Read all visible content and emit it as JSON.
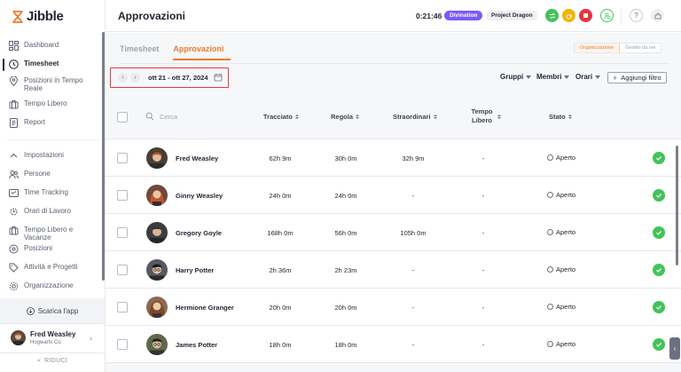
{
  "app": {
    "name": "Jibble"
  },
  "sidebar": {
    "items": [
      {
        "label": "Dashboard",
        "icon": "dashboard-icon"
      },
      {
        "label": "Timesheet",
        "icon": "clock-icon",
        "active": true
      },
      {
        "label": "Posizioni in Tempo Reale",
        "icon": "location-icon"
      },
      {
        "label": "Tempo Libero",
        "icon": "luggage-icon"
      },
      {
        "label": "Report",
        "icon": "report-icon"
      }
    ],
    "settings_items": [
      {
        "label": "Impostazioni",
        "icon": "chevron-up-icon"
      },
      {
        "label": "Persone",
        "icon": "people-icon"
      },
      {
        "label": "Time Tracking",
        "icon": "time-tracking-icon"
      },
      {
        "label": "Orari di Lavoro",
        "icon": "work-schedule-icon"
      },
      {
        "label": "Tempo Libero e Vacanze",
        "icon": "luggage-icon"
      },
      {
        "label": "Posizioni",
        "icon": "location-icon"
      },
      {
        "label": "Attività e Progetti",
        "icon": "tag-icon"
      },
      {
        "label": "Organizzazione",
        "icon": "gear-icon"
      }
    ],
    "download_label": "Scarica l'app",
    "user": {
      "name": "Fred Weasley",
      "org": "Hogwarts Co"
    },
    "collapse_label": "RIDUCI"
  },
  "header": {
    "title": "Approvazioni",
    "timer": "0:21:46",
    "activity": "Divination",
    "project": "Project Dragon",
    "colors": {
      "activity": "#7a5af8",
      "start": "#43c35a",
      "break": "#f5b400",
      "stop": "#e5363d"
    }
  },
  "tabs": [
    {
      "label": "Timesheet",
      "active": false
    },
    {
      "label": "Approvazioni",
      "active": true
    }
  ],
  "view_toggle": {
    "left": "Organizzazione",
    "right": "Gestito da me"
  },
  "date_range": "ott 21 - ott 27, 2024",
  "filters": {
    "groups": "Gruppi",
    "members": "Membri",
    "schedules": "Orari",
    "add": "Aggiungi filtro"
  },
  "table": {
    "search_placeholder": "Cerca",
    "columns": {
      "tracked": "Tracciato",
      "regular": "Regola",
      "overtime": "Straordinari",
      "time_off": "Tempo Libero",
      "status": "Stato"
    },
    "rows": [
      {
        "name": "Fred Weasley",
        "tracked": "62h 9m",
        "regular": "30h 0m",
        "overtime": "32h 9m",
        "time_off": "-",
        "status": "Aperto"
      },
      {
        "name": "Ginny Weasley",
        "tracked": "24h 0m",
        "regular": "24h 0m",
        "overtime": "-",
        "time_off": "-",
        "status": "Aperto"
      },
      {
        "name": "Gregory Goyle",
        "tracked": "168h 0m",
        "regular": "56h 0m",
        "overtime": "105h 0m",
        "time_off": "-",
        "status": "Aperto"
      },
      {
        "name": "Harry Potter",
        "tracked": "2h 36m",
        "regular": "2h 23m",
        "overtime": "-",
        "time_off": "-",
        "status": "Aperto"
      },
      {
        "name": "Hermione Granger",
        "tracked": "20h 0m",
        "regular": "20h 0m",
        "overtime": "-",
        "time_off": "-",
        "status": "Aperto"
      },
      {
        "name": "James Potter",
        "tracked": "18h 0m",
        "regular": "18h 0m",
        "overtime": "-",
        "time_off": "-",
        "status": "Aperto"
      }
    ]
  }
}
